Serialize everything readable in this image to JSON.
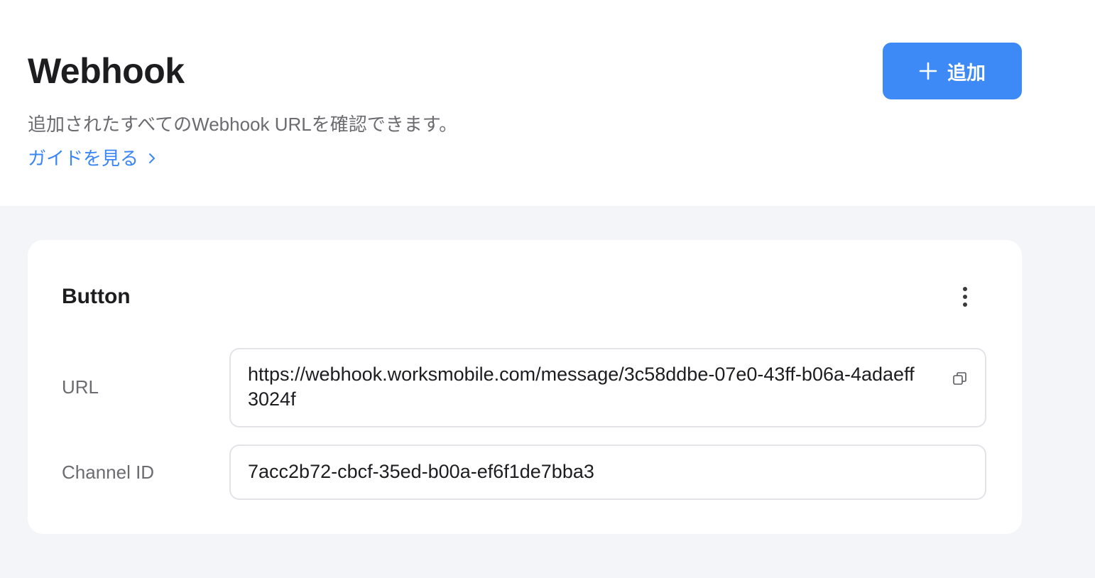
{
  "header": {
    "title": "Webhook",
    "subtitle": "追加されたすべてのWebhook URLを確認できます。",
    "guide_link": "ガイドを見る",
    "guide_link_icon": "chevron-right-icon",
    "add_button": {
      "label": "追加",
      "icon": "plus-icon"
    }
  },
  "webhook_card": {
    "name": "Button",
    "menu_icon": "more-vertical-icon",
    "fields": {
      "url": {
        "label": "URL",
        "value": "https://webhook.worksmobile.com/message/3c58ddbe-07e0-43ff-b06a-4adaeff3024f",
        "action_icon": "copy-icon"
      },
      "channel_id": {
        "label": "Channel ID",
        "value": "7acc2b72-cbcf-35ed-b00a-ef6f1de7bba3"
      }
    }
  },
  "colors": {
    "accent": "#3d8af7",
    "link": "#3a86f5",
    "background": "#f4f5f8",
    "card": "#ffffff",
    "field_border": "#e3e4e8",
    "muted_text": "#6b6b70"
  }
}
